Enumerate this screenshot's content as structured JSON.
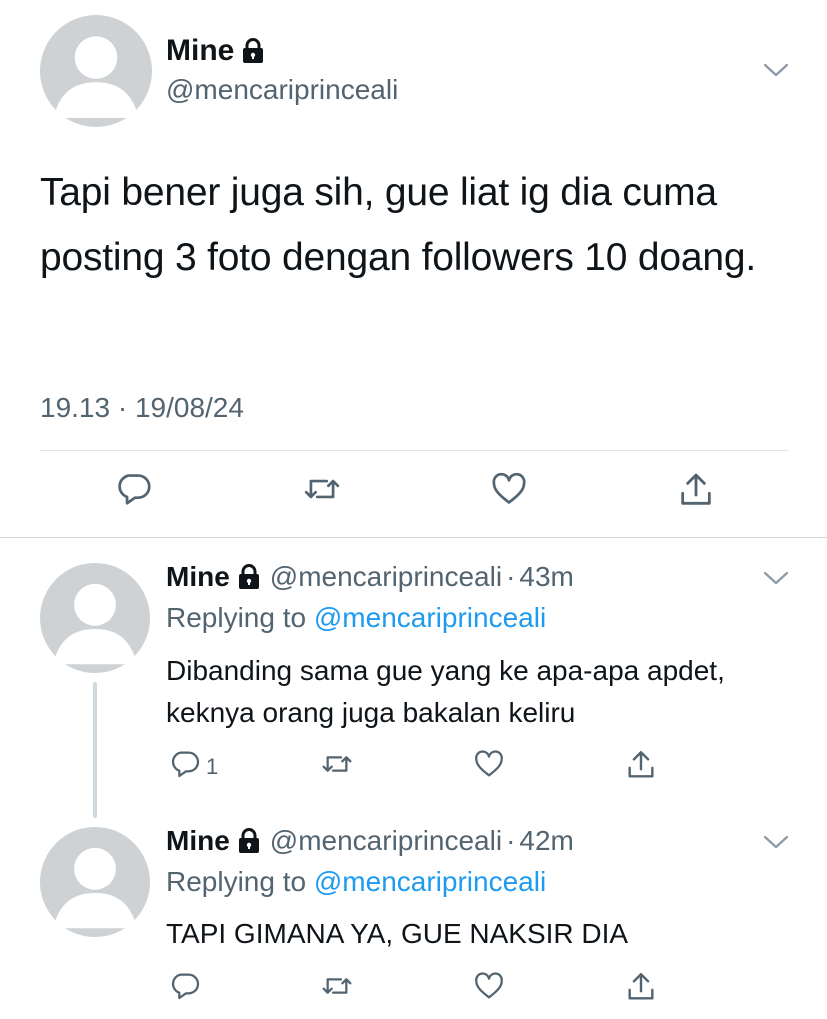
{
  "main_tweet": {
    "name": "Mine",
    "handle": "@mencariprinceali",
    "text": "Tapi bener juga sih, gue liat ig dia cuma posting 3 foto dengan followers 10 doang.",
    "timestamp": "19.13 · 19/08/24"
  },
  "replies": [
    {
      "name": "Mine",
      "handle": "@mencariprinceali",
      "separator": "·",
      "time": "43m",
      "replying_prefix": "Replying to",
      "replying_handle": "@mencariprinceali",
      "text": "Dibanding sama gue yang ke apa-apa apdet, keknya orang juga bakalan keliru",
      "reply_count": "1"
    },
    {
      "name": "Mine",
      "handle": "@mencariprinceali",
      "separator": "·",
      "time": "42m",
      "replying_prefix": "Replying to",
      "replying_handle": "@mencariprinceali",
      "text": "TAPI GIMANA YA, GUE NAKSIR DIA",
      "reply_count": ""
    }
  ],
  "icons": {
    "lock": "lock-icon",
    "chevron": "chevron-down-icon",
    "reply": "reply-icon",
    "retweet": "retweet-icon",
    "like": "like-icon",
    "share": "share-icon"
  },
  "colors": {
    "text": "#0f1419",
    "secondary": "#536471",
    "mention": "#1d9bf0",
    "avatar": "#cfd2d5"
  }
}
